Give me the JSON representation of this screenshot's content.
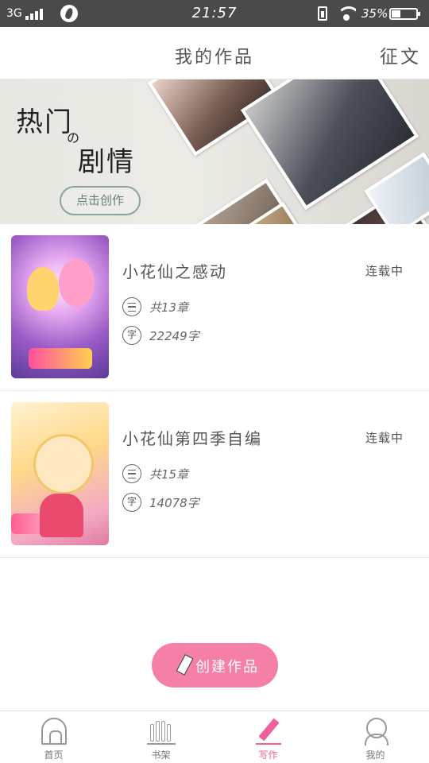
{
  "status_bar": {
    "network": "3G",
    "time": "21:57",
    "battery": "35%"
  },
  "header": {
    "title": "我的作品",
    "action": "征文"
  },
  "banner": {
    "line1": "热门",
    "line2": "の",
    "line3": "剧情",
    "button": "点击创作"
  },
  "works": [
    {
      "title": "小花仙之感动",
      "status": "连载中",
      "chapters": "共13章",
      "words": "22249字"
    },
    {
      "title": "小花仙第四季自编",
      "status": "连载中",
      "chapters": "共15章",
      "words": "14078字"
    }
  ],
  "meta_icon_char": "字",
  "create_button": "创建作品",
  "bottom_nav": [
    {
      "label": "首页",
      "icon": "home-icon"
    },
    {
      "label": "书架",
      "icon": "bookshelf-icon"
    },
    {
      "label": "写作",
      "icon": "pencil-icon",
      "active": true
    },
    {
      "label": "我的",
      "icon": "profile-icon"
    }
  ],
  "colors": {
    "accent": "#f0609a",
    "fab": "#f67fa9",
    "status_bar": "#4a4a4a"
  }
}
